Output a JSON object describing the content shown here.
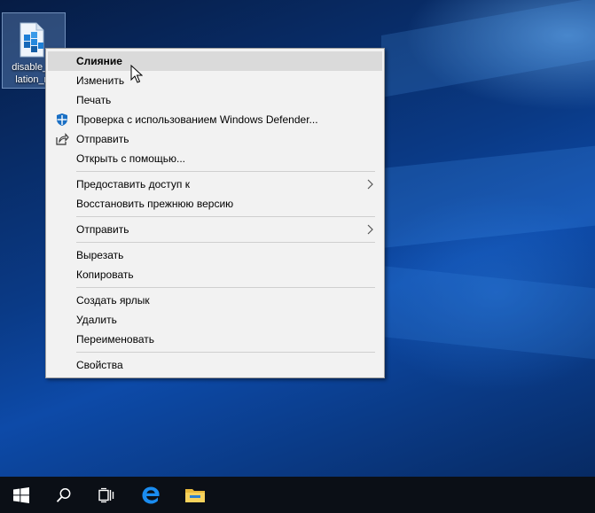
{
  "desktop": {
    "icon_label_line1": "disable_in",
    "icon_label_line2": "lation_m"
  },
  "context_menu": {
    "items": [
      {
        "label": "Слияние"
      },
      {
        "label": "Изменить"
      },
      {
        "label": "Печать"
      },
      {
        "label": "Проверка с использованием Windows Defender..."
      },
      {
        "label": "Отправить"
      },
      {
        "label": "Открыть с помощью..."
      },
      {
        "label": "Предоставить доступ к"
      },
      {
        "label": "Восстановить прежнюю версию"
      },
      {
        "label": "Отправить"
      },
      {
        "label": "Вырезать"
      },
      {
        "label": "Копировать"
      },
      {
        "label": "Создать ярлык"
      },
      {
        "label": "Удалить"
      },
      {
        "label": "Переименовать"
      },
      {
        "label": "Свойства"
      }
    ]
  },
  "taskbar": {
    "buttons": [
      "windows-start-icon",
      "search-icon",
      "task-view-icon",
      "edge-browser-icon",
      "file-explorer-icon"
    ]
  },
  "colors": {
    "menu_background": "#f2f2f2",
    "menu_hover": "#dadada",
    "taskbar": "#0b0f16",
    "accent": "#0078d7"
  }
}
